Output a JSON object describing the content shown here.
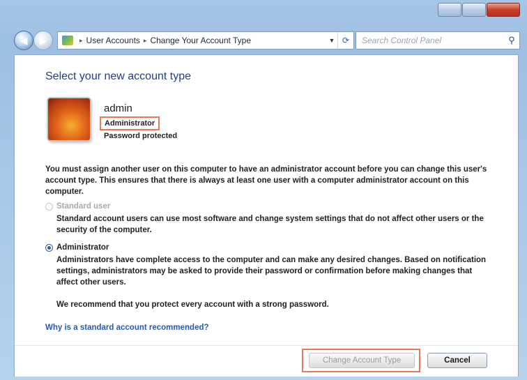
{
  "breadcrumb": {
    "items": [
      "User Accounts",
      "Change Your Account Type"
    ]
  },
  "search": {
    "placeholder": "Search Control Panel"
  },
  "page": {
    "title": "Select your new account type"
  },
  "user": {
    "name": "admin",
    "role": "Administrator",
    "password_status": "Password protected"
  },
  "warning_text": "You must assign another user on this computer to have an administrator account before you can change this user's account type. This ensures that there is always at least one user with a computer administrator account on this computer.",
  "options": [
    {
      "label": "Standard user",
      "description": "Standard account users can use most software and change system settings that do not affect other users or the security of the computer.",
      "selected": false,
      "enabled": false
    },
    {
      "label": "Administrator",
      "description": "Administrators have complete access to the computer and can make any desired changes. Based on notification settings, administrators may be asked to provide their password or confirmation before making changes that affect other users.",
      "selected": true,
      "enabled": true
    }
  ],
  "recommendation": "We recommend that you protect every account with a strong password.",
  "link_text": "Why is a standard account recommended?",
  "buttons": {
    "change": "Change Account Type",
    "cancel": "Cancel"
  },
  "icons": {
    "back": "back-arrow-icon",
    "forward": "forward-arrow-icon",
    "control_panel": "control-panel-icon",
    "refresh": "refresh-icon",
    "search": "search-icon",
    "user_picture": "flower-user-picture"
  },
  "colors": {
    "title": "#1e3d8b",
    "link": "#1e5bb5",
    "highlight": "#e3795a"
  }
}
